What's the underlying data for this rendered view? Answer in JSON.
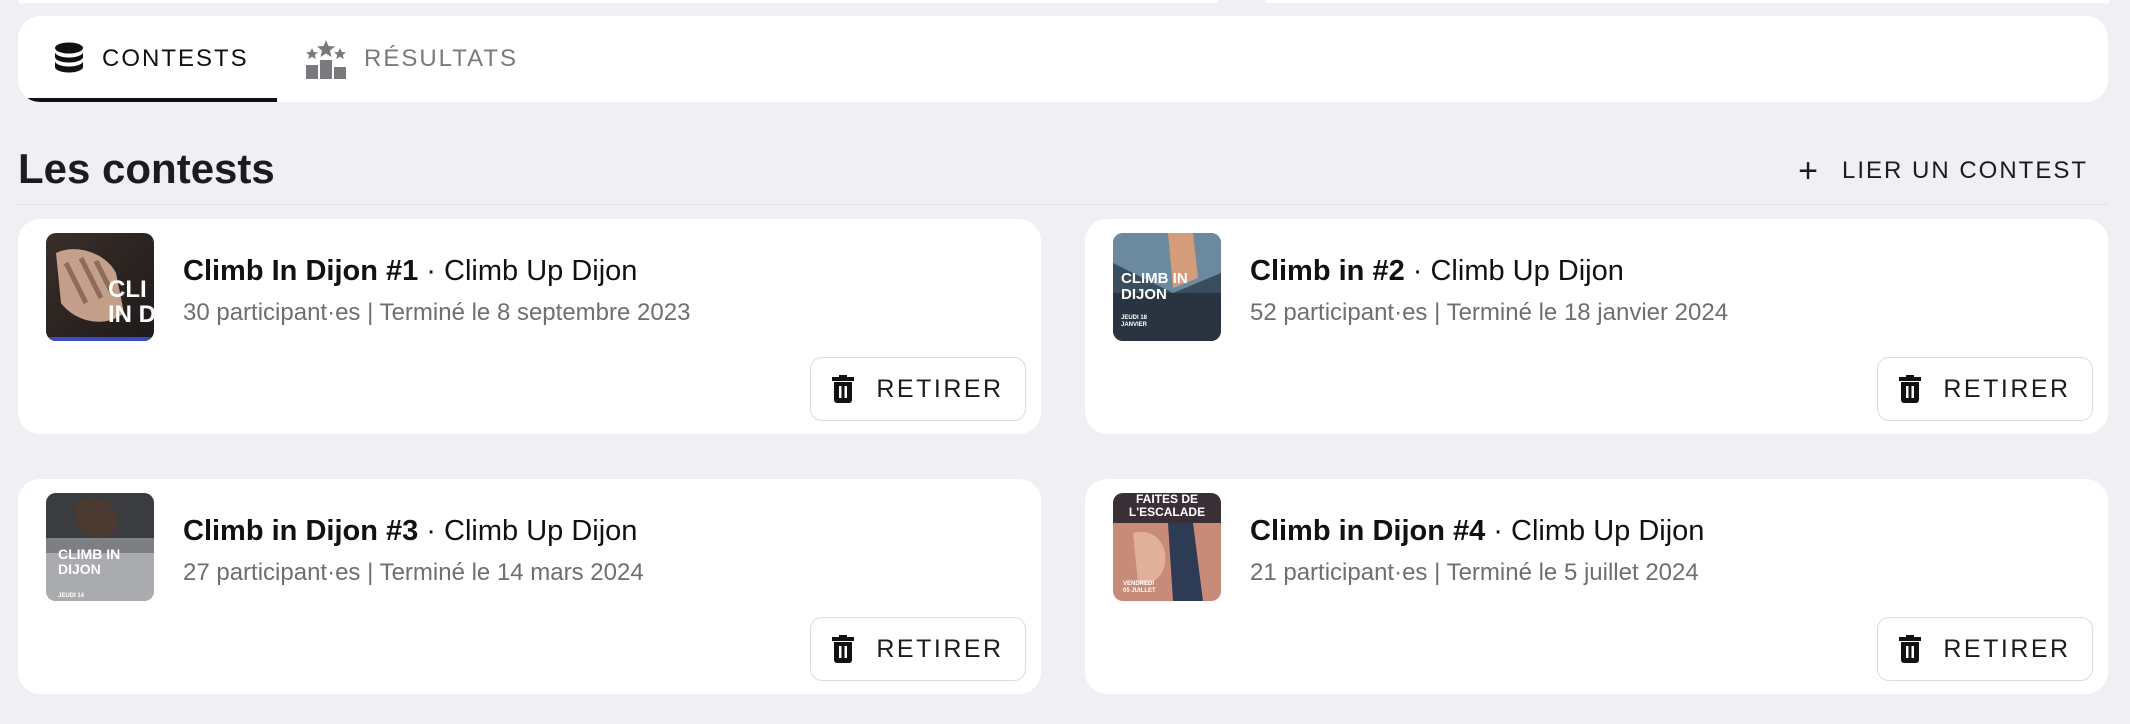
{
  "tabs": [
    {
      "label": "CONTESTS",
      "icon": "database-icon",
      "active": true
    },
    {
      "label": "RÉSULTATS",
      "icon": "podium-icon",
      "active": false
    }
  ],
  "section": {
    "title": "Les contests",
    "link_button_label": "LIER UN CONTEST",
    "link_button_icon": "plus-icon"
  },
  "contests": [
    {
      "name": "Climb In Dijon #1",
      "separator": " · ",
      "gym": "Climb Up Dijon",
      "details": "30 participant·es | Terminé le 8 septembre 2023",
      "remove_label": "RETIRER"
    },
    {
      "name": "Climb in #2",
      "separator": " · ",
      "gym": "Climb Up Dijon",
      "details": "52 participant·es | Terminé le 18 janvier 2024",
      "remove_label": "RETIRER"
    },
    {
      "name": "Climb in Dijon #3",
      "separator": " · ",
      "gym": "Climb Up Dijon",
      "details": "27 participant·es | Terminé le 14 mars 2024",
      "remove_label": "RETIRER"
    },
    {
      "name": "Climb in Dijon #4",
      "separator": " · ",
      "gym": "Climb Up Dijon",
      "details": "21 participant·es | Terminé le 5 juillet 2024",
      "remove_label": "RETIRER"
    }
  ],
  "thumbnails": [
    {
      "text": "CLI\nIN D"
    },
    {
      "text": "CLIMB IN\nDIJON",
      "small": "JEUDI 18\nJANVIER"
    },
    {
      "text": "CLIMB IN\nDIJON",
      "small": "JEUDI 14"
    },
    {
      "text": "FAITES DE\nL'ESCALADE",
      "small": "VENDREDI\n05 JUILLET"
    }
  ],
  "colors": {
    "background": "#efeff4",
    "card": "#ffffff",
    "text_primary": "#111111",
    "text_secondary": "#6e6e73",
    "tab_inactive": "#7a7a7e"
  }
}
